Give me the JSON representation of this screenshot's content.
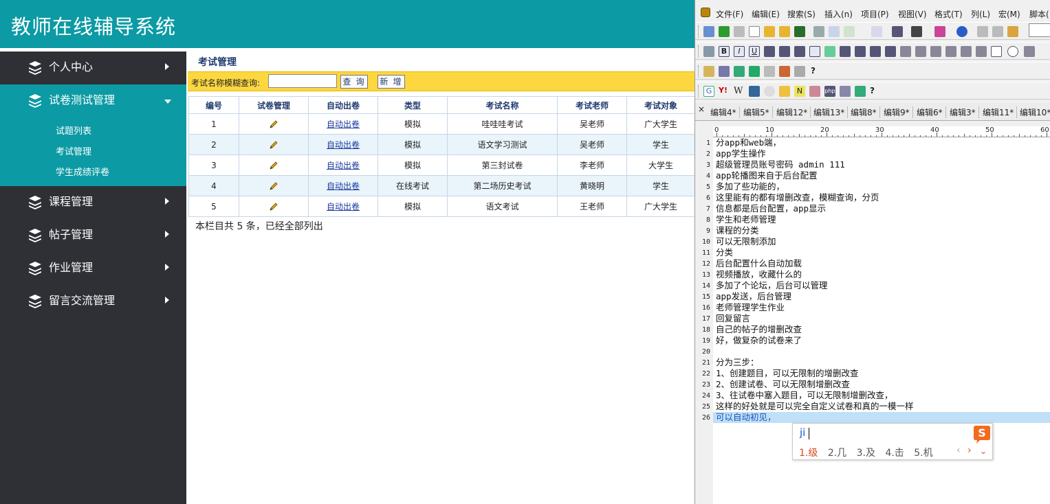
{
  "app": {
    "title": "教师在线辅导系统",
    "colors": {
      "header": "#0c9aa4",
      "sidebar": "#2f3036",
      "search_bar": "#fdd740"
    },
    "sidebar": {
      "items": [
        {
          "label": "个人中心",
          "icon": "layers-icon",
          "expanded": false
        },
        {
          "label": "试卷测试管理",
          "icon": "layers-icon",
          "expanded": true,
          "children": [
            "试题列表",
            "考试管理",
            "学生成绩评卷"
          ]
        },
        {
          "label": "课程管理",
          "icon": "layers-icon",
          "expanded": false
        },
        {
          "label": "帖子管理",
          "icon": "layers-icon",
          "expanded": false
        },
        {
          "label": "作业管理",
          "icon": "layers-icon",
          "expanded": false
        },
        {
          "label": "留言交流管理",
          "icon": "layers-icon",
          "expanded": false
        }
      ]
    },
    "content": {
      "title": "考试管理",
      "search": {
        "label": "考试名称模糊查询:",
        "value": "",
        "query_button": "查 询",
        "add_button": "新 增"
      },
      "table": {
        "headers": [
          "编号",
          "试卷管理",
          "自动出卷",
          "类型",
          "考试名称",
          "考试老师",
          "考试对象"
        ],
        "rows": [
          {
            "id": "1",
            "auto": "自动出卷",
            "type": "模拟",
            "name": "哇哇哇考试",
            "teacher": "吴老师",
            "target": "广大学生"
          },
          {
            "id": "2",
            "auto": "自动出卷",
            "type": "模拟",
            "name": "语文学习测试",
            "teacher": "吴老师",
            "target": "学生"
          },
          {
            "id": "3",
            "auto": "自动出卷",
            "type": "模拟",
            "name": "第三封试卷",
            "teacher": "李老师",
            "target": "大学生"
          },
          {
            "id": "4",
            "auto": "自动出卷",
            "type": "在线考试",
            "name": "第二场历史考试",
            "teacher": "黄晓明",
            "target": "学生"
          },
          {
            "id": "5",
            "auto": "自动出卷",
            "type": "模拟",
            "name": "语文考试",
            "teacher": "王老师",
            "target": "广大学生"
          }
        ]
      },
      "summary": "本栏目共 5 条，已经全部列出"
    }
  },
  "editor": {
    "menus": [
      "文件(F)",
      "编辑(E)",
      "搜索(S)",
      "插入(n)",
      "项目(P)",
      "视图(V)",
      "格式(T)",
      "列(L)",
      "宏(M)",
      "脚本("
    ],
    "tabs": [
      "编辑4*",
      "编辑5*",
      "编辑12*",
      "编辑13*",
      "编辑8*",
      "编辑9*",
      "编辑6*",
      "编辑3*",
      "编辑11*",
      "编辑10*"
    ],
    "ruler_labels": [
      "0",
      "10",
      "20",
      "30",
      "40",
      "50",
      "60"
    ],
    "lines": [
      "分app和web端，",
      "app学生操作",
      "超级管理员账号密码 admin 111",
      "app轮播图来自于后台配置",
      "多加了些功能的，",
      "这里能有的都有增删改查，模糊查询，分页",
      "信息都是后台配置，app显示",
      "学生和老师管理",
      "课程的分类",
      "可以无限制添加",
      "分类",
      "后台配置什么自动加载",
      "视频播放，收藏什么的",
      "多加了个论坛，后台可以管理",
      "app发送，后台管理",
      "老师管理学生作业",
      "回复留言",
      "自己的帖子的增删改查",
      "好，做复杂的试卷来了",
      "",
      "分为三步：",
      "1、创建题目，可以无限制的增删改查",
      "2、创建试卷、可以无限制增删改查",
      "3、往试卷中塞入题目，可以无限制增删改查，",
      "这样的好处就是可以完全自定义试卷和真的一模一样",
      "可以自动初见，"
    ],
    "line_numbers": [
      "1",
      "2",
      "3",
      "4",
      "5",
      "6",
      "7",
      "8",
      "9",
      "10",
      "11",
      "12",
      "13",
      "14",
      "15",
      "16",
      "17",
      "18",
      "19",
      "20",
      "21",
      "22",
      "23",
      "24",
      "25",
      "26"
    ],
    "selected_line": 26
  },
  "ime": {
    "input": "ji",
    "candidates": [
      "1.级",
      "2.几",
      "3.及",
      "4.击",
      "5.机"
    ],
    "prev": "‹",
    "next": "›",
    "more": "⌄",
    "logo_icon": "sogou-logo-icon",
    "logo_letter": "S"
  }
}
